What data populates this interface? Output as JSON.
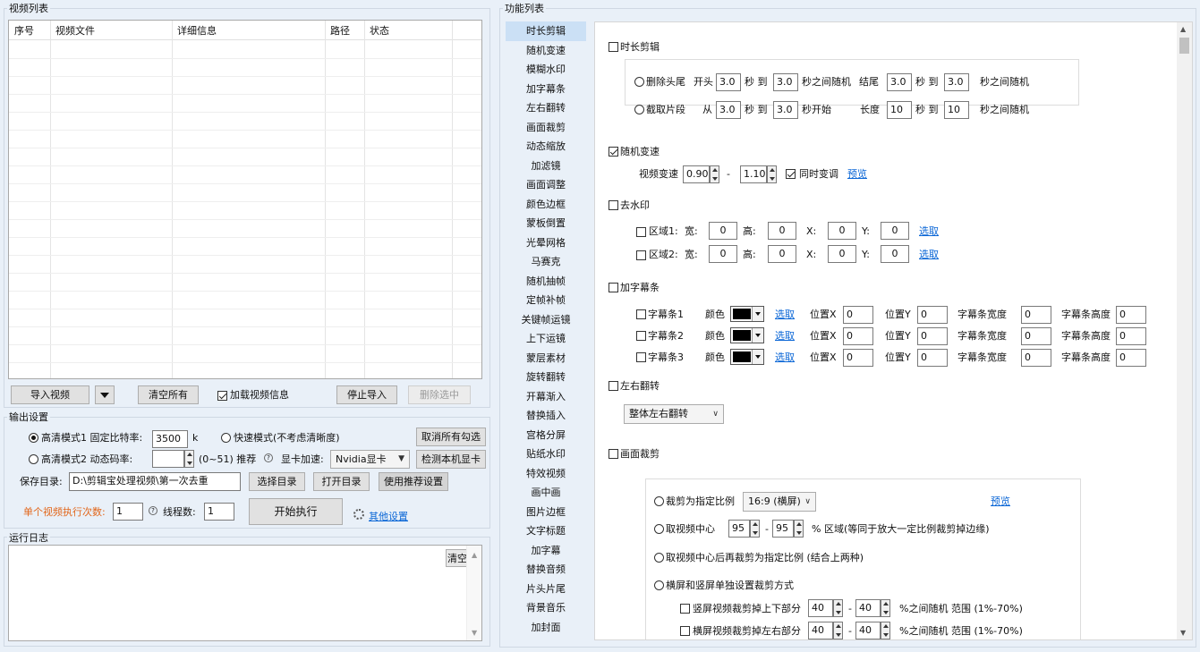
{
  "video_list": {
    "title": "视频列表",
    "columns": [
      "序号",
      "视频文件",
      "详细信息",
      "路径",
      "状态"
    ],
    "import_button": "导入视频",
    "clear_all_button": "清空所有",
    "load_info_label": "加载视频信息",
    "load_info_checked": true,
    "stop_import_button": "停止导入",
    "delete_selected_button": "删除选中"
  },
  "output": {
    "title": "输出设置",
    "mode1_label": "高清模式1 固定比特率:",
    "bitrate": "3500",
    "bitrate_unit": "k",
    "fast_mode_label": "快速模式(不考虑清晰度)",
    "uncheck_all_button": "取消所有勾选",
    "mode2_label": "高清模式2 动态码率:",
    "crf_value": "",
    "crf_hint": "(0~51) 推荐",
    "gpu_label": "显卡加速:",
    "gpu_value": "Nvidia显卡",
    "detect_gpu_button": "检测本机显卡",
    "save_dir_label": "保存目录:",
    "save_dir_value": "D:\\剪辑宝处理视频\\第一次去重",
    "choose_dir_button": "选择目录",
    "open_dir_button": "打开目录",
    "recommend_button": "使用推荐设置",
    "exec_count_label": "单个视频执行次数:",
    "exec_count": "1",
    "threads_label": "线程数:",
    "threads": "1",
    "start_button": "开始执行",
    "other_settings_link": "其他设置"
  },
  "log": {
    "title": "运行日志",
    "clear_button": "清空"
  },
  "features": {
    "title": "功能列表",
    "items": [
      "时长剪辑",
      "随机变速",
      "模糊水印",
      "加字幕条",
      "左右翻转",
      "画面裁剪",
      "动态缩放",
      "加滤镜",
      "画面调整",
      "颜色边框",
      "蒙板倒置",
      "光晕网格",
      "马赛克",
      "随机抽帧",
      "定帧补帧",
      "关键帧运镜",
      "上下运镜",
      "蒙层素材",
      "旋转翻转",
      "开幕渐入",
      "替换插入",
      "宫格分屏",
      "贴纸水印",
      "特效视频",
      "画中画",
      "图片边框",
      "文字标题",
      "加字幕",
      "替换音频",
      "片头片尾",
      "背景音乐",
      "加封面"
    ],
    "active_index": 0
  },
  "trim": {
    "label": "时长剪辑",
    "remove_label": "删除头尾",
    "start_label": "开头",
    "head_from": "3.0",
    "to_label": "秒 到",
    "head_to": "3.0",
    "head_suffix": "秒之间随机",
    "end_label": "结尾",
    "tail_from": "3.0",
    "tail_to": "3.0",
    "tail_suffix": "秒之间随机",
    "cut_label": "截取片段",
    "from_label": "从",
    "cut_from": "3.0",
    "cut_to": "3.0",
    "cut_suffix": "秒开始",
    "length_label": "长度",
    "len_from": "10",
    "len_to": "10",
    "len_suffix": "秒之间随机"
  },
  "speed": {
    "label": "随机变速",
    "checked": true,
    "speed_label": "视频变速",
    "min": "0.90",
    "dash": "-",
    "max": "1.10",
    "pitch_label": "同时变调",
    "pitch_checked": true,
    "preview_link": "预览"
  },
  "watermark": {
    "label": "去水印",
    "region1_label": "区域1:",
    "region2_label": "区域2:",
    "w_label": "宽:",
    "h_label": "高:",
    "x_label": "X:",
    "y_label": "Y:",
    "r1": [
      "0",
      "0",
      "0",
      "0"
    ],
    "r2": [
      "0",
      "0",
      "0",
      "0"
    ],
    "pick_link": "选取"
  },
  "subtitle_bar": {
    "label": "加字幕条",
    "bars": [
      "字幕条1",
      "字幕条2",
      "字幕条3"
    ],
    "color_label": "颜色",
    "color": "#000000",
    "pick_link": "选取",
    "posx_label": "位置X",
    "posy_label": "位置Y",
    "width_label": "字幕条宽度",
    "height_label": "字幕条高度",
    "values": [
      [
        "0",
        "0",
        "0",
        "0"
      ],
      [
        "0",
        "0",
        "0",
        "0"
      ],
      [
        "0",
        "0",
        "0",
        "0"
      ]
    ]
  },
  "flip": {
    "label": "左右翻转",
    "option": "整体左右翻转"
  },
  "crop": {
    "label": "画面裁剪",
    "ratio_label": "裁剪为指定比例",
    "ratio_value": "16:9 (横屏)",
    "preview_link": "预览",
    "center_label": "取视频中心",
    "center_min": "95",
    "center_dash": "-",
    "center_max": "95",
    "center_suffix": "% 区域(等同于放大一定比例裁剪掉边缘)",
    "center_ratio_label": "取视频中心后再裁剪为指定比例 (结合上两种)",
    "separate_label": "横屏和竖屏单独设置裁剪方式",
    "portrait_label": "竖屏视频裁剪掉上下部分",
    "portrait_min": "40",
    "portrait_max": "40",
    "landscape_label": "横屏视频裁剪掉左右部分",
    "landscape_min": "40",
    "landscape_max": "40",
    "range_suffix": "%之间随机 范围 (1%-70%)"
  }
}
